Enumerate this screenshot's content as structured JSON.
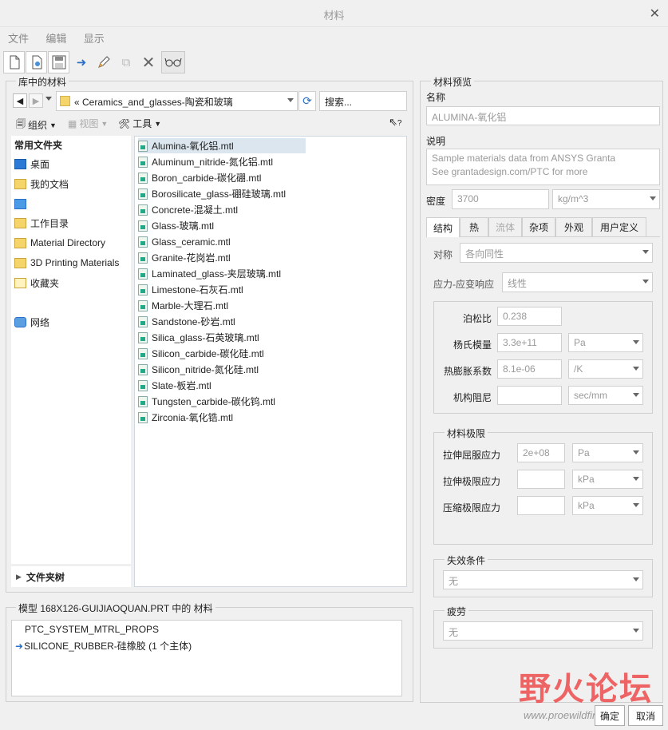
{
  "window": {
    "title": "材料"
  },
  "menu": [
    "文件",
    "编辑",
    "显示"
  ],
  "library": {
    "group_label": "库中的材料",
    "path": "Ceramics_and_glasses-陶瓷和玻璃",
    "search_placeholder": "搜索...",
    "organize": "组织",
    "view": "视图",
    "tools": "工具",
    "help_icon": "?"
  },
  "nav": {
    "header": "常用文件夹",
    "items": [
      "桌面",
      "我的文档",
      "",
      "工作目录",
      "Material Directory",
      "3D Printing Materials",
      "收藏夹",
      "网络"
    ],
    "tree_label": "文件夹树"
  },
  "files": [
    "Alumina-氧化铝.mtl",
    "Aluminum_nitride-氮化铝.mtl",
    "Boron_carbide-碳化硼.mtl",
    "Borosilicate_glass-硼硅玻璃.mtl",
    "Concrete-混凝土.mtl",
    "Glass-玻璃.mtl",
    "Glass_ceramic.mtl",
    "Granite-花岗岩.mtl",
    "Laminated_glass-夹层玻璃.mtl",
    "Limestone-石灰石.mtl",
    "Marble-大理石.mtl",
    "Sandstone-砂岩.mtl",
    "Silica_glass-石英玻璃.mtl",
    "Silicon_carbide-碳化硅.mtl",
    "Silicon_nitride-氮化硅.mtl",
    "Slate-板岩.mtl",
    "Tungsten_carbide-碳化钨.mtl",
    "Zirconia-氧化锆.mtl"
  ],
  "model": {
    "group_label": "模型 168X126-GUIJIAOQUAN.PRT 中的 材料",
    "items": [
      "PTC_SYSTEM_MTRL_PROPS",
      "SILICONE_RUBBER-硅橡胶 (1 个主体)"
    ]
  },
  "preview": {
    "group_label": "材料预览",
    "name_label": "名称",
    "name_value": "ALUMINA-氧化铝",
    "desc_label": "说明",
    "desc_line1": "Sample materials data from ANSYS Granta",
    "desc_line2": "See grantadesign.com/PTC for more",
    "density_label": "密度",
    "density_value": "3700",
    "density_unit": "kg/m^3",
    "tabs": [
      "结构",
      "热",
      "流体",
      "杂项",
      "外观",
      "用户定义"
    ],
    "symmetry_label": "对称",
    "symmetry_value": "各向同性",
    "stress_label": "应力-应变响应",
    "stress_value": "线性",
    "poisson_label": "泊松比",
    "poisson_value": "0.238",
    "young_label": "杨氏模量",
    "young_value": "3.3e+11",
    "young_unit": "Pa",
    "thermal_label": "热膨胀系数",
    "thermal_value": "8.1e-06",
    "thermal_unit": "/K",
    "damping_label": "机构阻尼",
    "damping_value": "",
    "damping_unit": "sec/mm",
    "limits_label": "材料极限",
    "tensile_yield_label": "拉伸屈服应力",
    "tensile_yield_value": "2e+08",
    "tensile_yield_unit": "Pa",
    "tensile_ult_label": "拉伸极限应力",
    "tensile_ult_unit": "kPa",
    "comp_ult_label": "压缩极限应力",
    "comp_ult_unit": "kPa",
    "failure_label": "失效条件",
    "failure_value": "无",
    "fatigue_label": "疲劳",
    "fatigue_value": "无"
  },
  "buttons": {
    "ok": "确定",
    "cancel": "取消"
  },
  "watermark": {
    "text": "野火论坛",
    "url": "www.proewildfire.cn"
  }
}
